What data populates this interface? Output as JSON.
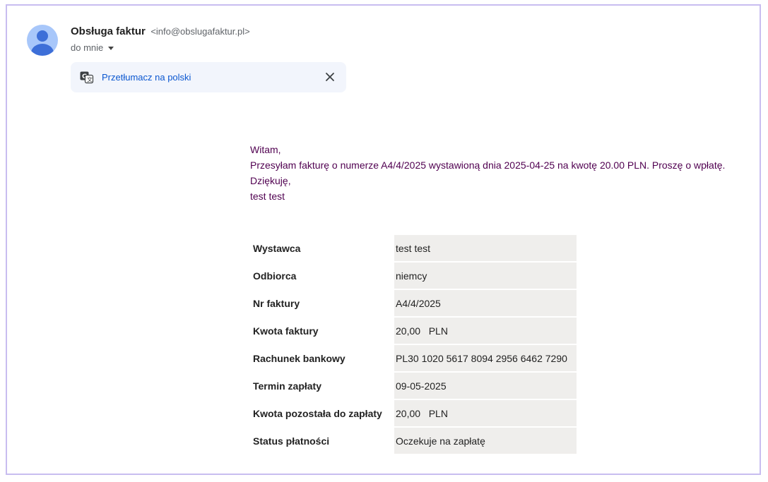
{
  "sender": {
    "name": "Obsługa faktur",
    "email": "<info@obslugafaktur.pl>",
    "recipient_label": "do mnie"
  },
  "translate_bar": {
    "link_label": "Przetłumacz na polski"
  },
  "message": {
    "lines": [
      "Witam,",
      "Przesyłam fakturę o numerze A4/4/2025 wystawioną dnia 2025-04-25 na kwotę 20.00 PLN. Proszę o wpłatę.",
      "Dziękuję,",
      "test test"
    ]
  },
  "details": [
    {
      "label": "Wystawca",
      "value": "test test"
    },
    {
      "label": "Odbiorca",
      "value": "niemcy"
    },
    {
      "label": "Nr faktury",
      "value": "A4/4/2025"
    },
    {
      "label": "Kwota faktury",
      "value": "20,00   PLN"
    },
    {
      "label": "Rachunek bankowy",
      "value": "PL30 1020 5617 8094 2956 6462 7290"
    },
    {
      "label": "Termin zapłaty",
      "value": "09-05-2025"
    },
    {
      "label": "Kwota pozostała do zapłaty",
      "value": "20,00   PLN"
    },
    {
      "label": "Status płatności",
      "value": "Oczekuje na zapłatę"
    }
  ],
  "colors": {
    "link": "#0b57d0",
    "message_text": "#500050",
    "table_value_bg": "#efeeec",
    "frame_border": "#c8bdf0"
  }
}
